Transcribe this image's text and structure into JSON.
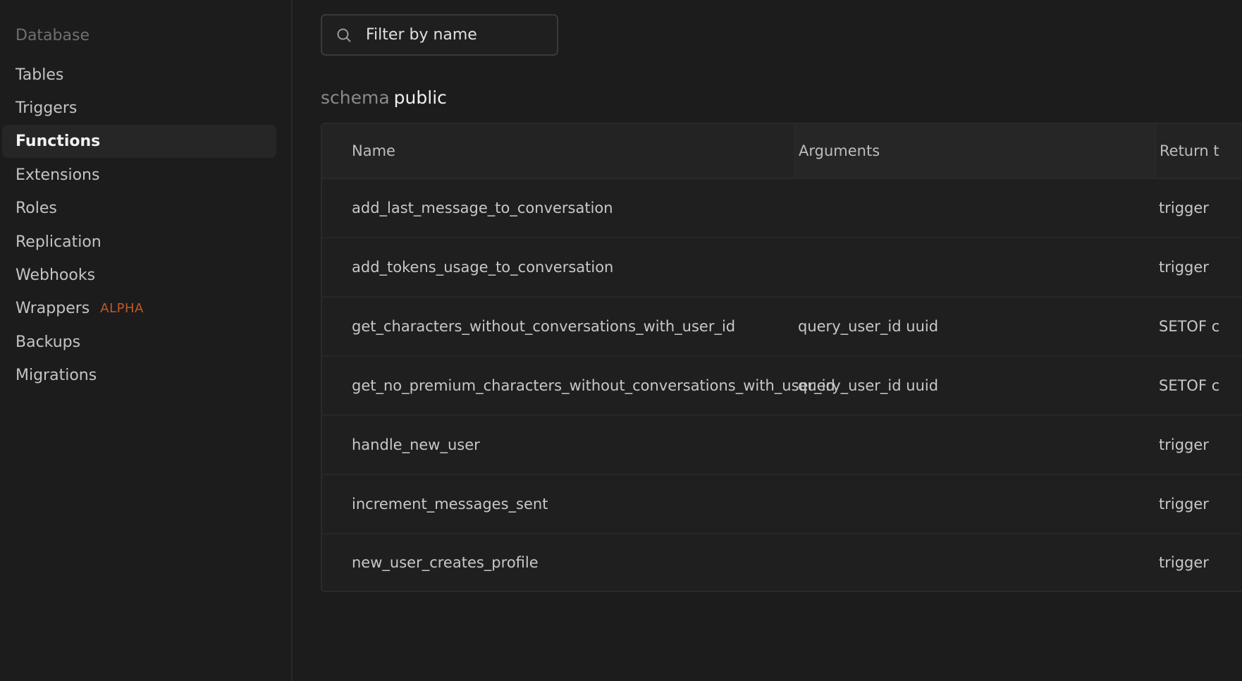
{
  "sidebar": {
    "title": "Database",
    "items": [
      {
        "label": "Tables"
      },
      {
        "label": "Triggers"
      },
      {
        "label": "Functions",
        "active": true
      },
      {
        "label": "Extensions"
      },
      {
        "label": "Roles"
      },
      {
        "label": "Replication"
      },
      {
        "label": "Webhooks"
      },
      {
        "label": "Wrappers",
        "badge": "ALPHA"
      },
      {
        "label": "Backups"
      },
      {
        "label": "Migrations"
      }
    ]
  },
  "search": {
    "placeholder": "Filter by name",
    "icon": "search-icon"
  },
  "schema": {
    "label": "schema",
    "name": "public"
  },
  "table": {
    "columns": [
      "Name",
      "Arguments",
      "Return t"
    ],
    "rows": [
      {
        "name": "add_last_message_to_conversation",
        "arguments": "",
        "return": "trigger"
      },
      {
        "name": "add_tokens_usage_to_conversation",
        "arguments": "",
        "return": "trigger"
      },
      {
        "name": "get_characters_without_conversations_with_user_id",
        "arguments": "query_user_id uuid",
        "return": "SETOF c"
      },
      {
        "name": "get_no_premium_characters_without_conversations_with_user_id",
        "arguments": "query_user_id uuid",
        "return": "SETOF c"
      },
      {
        "name": "handle_new_user",
        "arguments": "",
        "return": "trigger"
      },
      {
        "name": "increment_messages_sent",
        "arguments": "",
        "return": "trigger"
      },
      {
        "name": "new_user_creates_profile",
        "arguments": "",
        "return": "trigger"
      }
    ]
  },
  "colors": {
    "background": "#1c1c1c",
    "badge": "#c1592b",
    "active_item_bg": "#262626"
  }
}
